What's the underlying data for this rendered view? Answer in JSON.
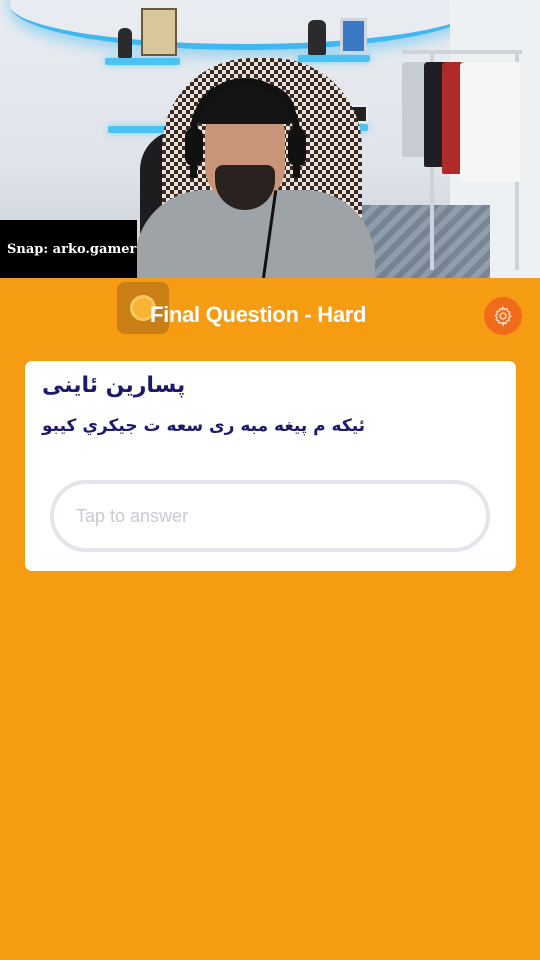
{
  "overlay": {
    "snap_handle": "Snap: arko.gamer"
  },
  "quiz": {
    "title": "Final Question - Hard",
    "question_line1": "پسارین ئاینی",
    "question_line2": "ئیکه م پیغه مبه ری سعه ت جیکري کیبو",
    "answer_placeholder": "Tap to answer"
  },
  "colors": {
    "background": "#f59c12",
    "accent_orange": "#f26b1d",
    "question_text": "#1e1a6b"
  },
  "icons": {
    "settings": "gear-icon"
  }
}
